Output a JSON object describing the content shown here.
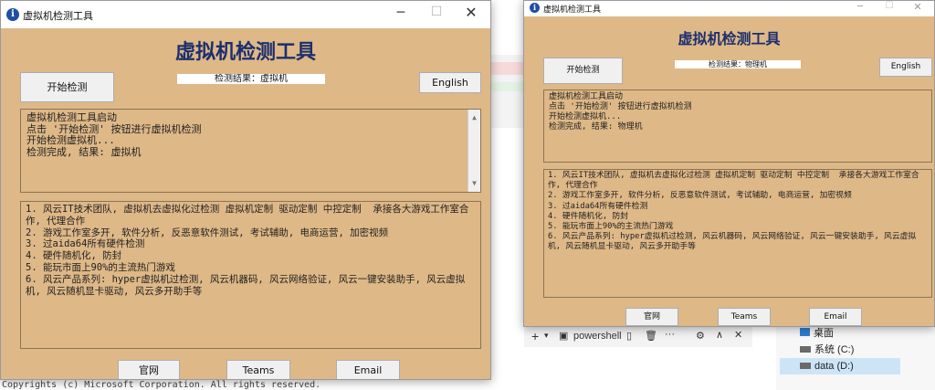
{
  "windows": [
    {
      "title": "虚拟机检测工具",
      "heading": "虚拟机检测工具",
      "start_button": "开始检测",
      "result_text": "检测结果：虚拟机",
      "lang_button": "English",
      "log_lines": [
        "虚拟机检测工具启动",
        "点击 '开始检测' 按钮进行虚拟机检测",
        "开始检测虚拟机...",
        "检测完成, 结果: 虚拟机"
      ],
      "info_lines": [
        "1. 风云IT技术团队, 虚拟机去虚拟化过检测 虚拟机定制 驱动定制 中控定制  承接各大游戏工作室合作, 代理合作",
        "2. 游戏工作室多开, 软件分析, 反恶意软件测试, 考试辅助, 电商运营, 加密视频",
        "3. 过aida64所有硬件检测",
        "4. 硬件随机化, 防封",
        "5. 能玩市面上90%的主流热门游戏",
        "6. 风云产品系列: hyper虚拟机过检测, 风云机器码, 风云网络验证, 风云一键安装助手, 风云虚拟机, 风云随机显卡驱动, 风云多开助手等"
      ],
      "bottom_buttons": [
        "官网",
        "Teams",
        "Email"
      ]
    },
    {
      "title": "虚拟机检测工具",
      "heading": "虚拟机检测工具",
      "start_button": "开始检测",
      "result_text": "检测结果：物理机",
      "lang_button": "English",
      "log_lines": [
        "虚拟机检测工具启动",
        "点击 '开始检测' 按钮进行虚拟机检测",
        "开始检测虚拟机...",
        "检测完成, 结果: 物理机"
      ],
      "info_lines": [
        "1. 风云IT技术团队, 虚拟机去虚拟化过检测 虚拟机定制 驱动定制 中控定制  承接各大游戏工作室合作, 代理合作",
        "2. 游戏工作室多开, 软件分析, 反恶意软件测试, 考试辅助, 电商运营, 加密视频",
        "3. 过aida64所有硬件检测",
        "4. 硬件随机化, 防封",
        "5. 能玩市面上90%的主流热门游戏",
        "6. 风云产品系列: hyper虚拟机过检测, 风云机器码, 风云网络验证, 风云一键安装助手, 风云虚拟机, 风云随机显卡驱动, 风云多开助手等"
      ],
      "bottom_buttons": [
        "官网",
        "Teams",
        "Email"
      ]
    }
  ],
  "background": {
    "terminal_tab": "powershell",
    "explorer_items": [
      "桌面",
      "系统 (C:)",
      "data (D:)"
    ],
    "footer_text": "Copyrights (c) Microsoft Corporation. All rights reserved."
  },
  "colors": {
    "window_bg": "#deb887",
    "heading": "#1b2f6e",
    "button_bg": "#f0f0f0"
  }
}
